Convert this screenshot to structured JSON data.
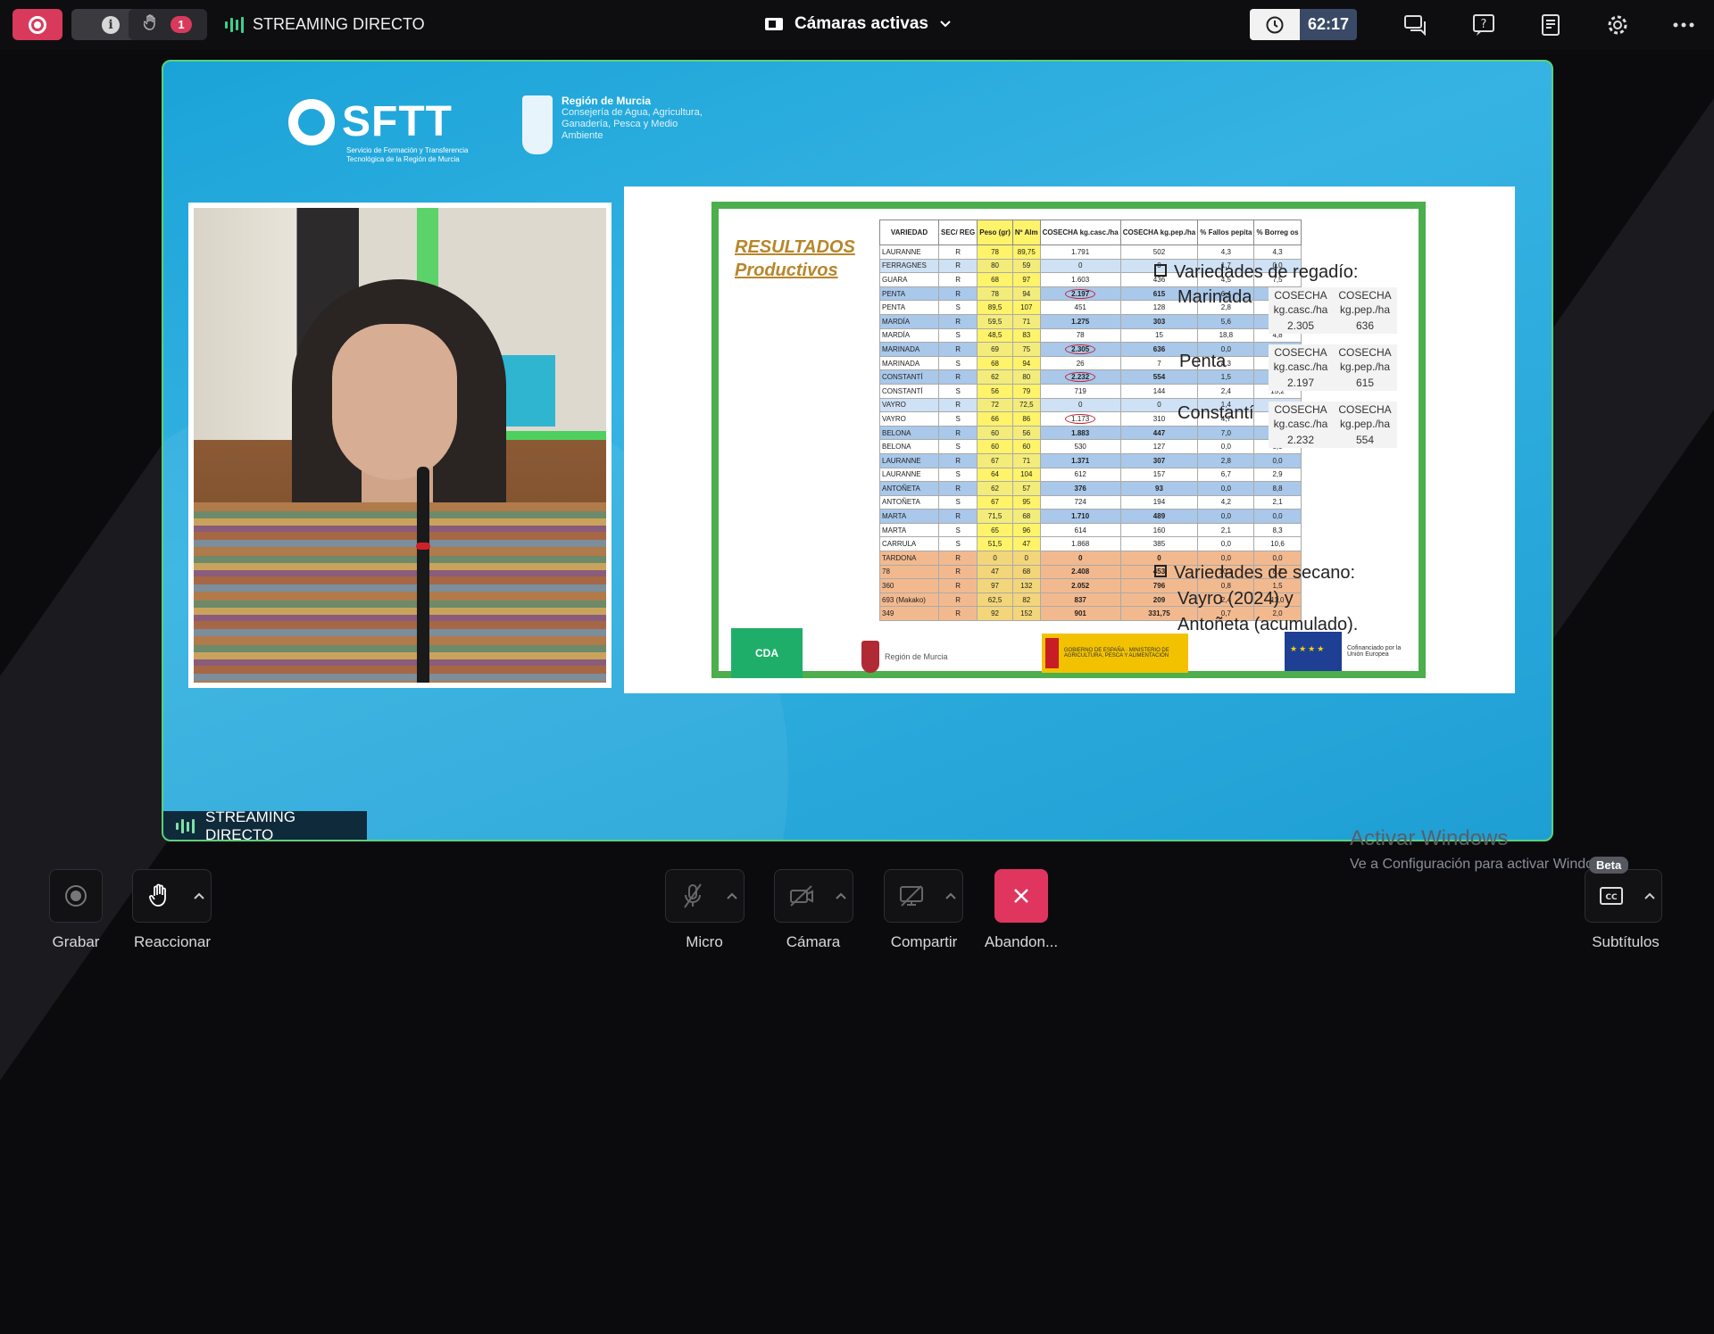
{
  "topbar": {
    "hand_count": "1",
    "stream_label": "STREAMING DIRECTO",
    "cameras_label": "Cámaras activas",
    "timer": "62:17"
  },
  "slide": {
    "sftt_logo": "SFTT",
    "sftt_sub": "Servicio de Formación y Transferencia Tecnológica de la Región de Murcia",
    "murcia_title": "Región de Murcia",
    "murcia_sub": "Consejería de Agua, Agricultura, Ganadería, Pesca y Medio Ambiente",
    "results_title_1": "RESULTADOS",
    "results_title_2": "Productivos",
    "table_headers": [
      "VARIEDAD",
      "SEC/ REG",
      "Peso (gr)",
      "Nº Alm",
      "COSECHA kg.casc./ha",
      "COSECHA kg.pep./ha",
      "% Fallos pepita",
      "% Borreg os"
    ],
    "table_rows": [
      {
        "v": "LAURANNE",
        "r": "R",
        "p": "78",
        "n": "89,75",
        "c": "1.791",
        "k": "502",
        "f": "4,3",
        "b": "4,3",
        "s": "w"
      },
      {
        "v": "FERRAGNES",
        "r": "R",
        "p": "80",
        "n": "59",
        "c": "0",
        "k": "0",
        "f": "1,7",
        "b": "0,0",
        "s": "lb"
      },
      {
        "v": "GUARA",
        "r": "R",
        "p": "68",
        "n": "97",
        "c": "1.603",
        "k": "436",
        "f": "4,5",
        "b": "7,5",
        "s": "w"
      },
      {
        "v": "PENTA",
        "r": "R",
        "p": "78",
        "n": "94",
        "c": "2.197",
        "k": "615",
        "f": "6,4",
        "b": "0,0",
        "s": "blue",
        "circ": true
      },
      {
        "v": "PENTA",
        "r": "S",
        "p": "89,5",
        "n": "107",
        "c": "451",
        "k": "128",
        "f": "2,8",
        "b": "0,0",
        "s": "w"
      },
      {
        "v": "MARDÍA",
        "r": "R",
        "p": "59,5",
        "n": "71",
        "c": "1.275",
        "k": "303",
        "f": "5,6",
        "b": "1,4",
        "s": "blue"
      },
      {
        "v": "MARDÍA",
        "r": "S",
        "p": "48,5",
        "n": "83",
        "c": "78",
        "k": "15",
        "f": "18,8",
        "b": "4,8",
        "s": "w"
      },
      {
        "v": "MARINADA",
        "r": "R",
        "p": "69",
        "n": "75",
        "c": "2.305",
        "k": "636",
        "f": "0,0",
        "b": "0,0",
        "s": "blue",
        "circ": true
      },
      {
        "v": "MARINADA",
        "r": "S",
        "p": "68",
        "n": "94",
        "c": "26",
        "k": "7",
        "f": "4,3",
        "b": "2,1",
        "s": "w"
      },
      {
        "v": "CONSTANTÍ",
        "r": "R",
        "p": "62",
        "n": "80",
        "c": "2.232",
        "k": "554",
        "f": "1,5",
        "b": "1,5",
        "s": "blue",
        "circ": true
      },
      {
        "v": "CONSTANTÍ",
        "r": "S",
        "p": "56",
        "n": "79",
        "c": "719",
        "k": "144",
        "f": "2,4",
        "b": "15,2",
        "s": "w"
      },
      {
        "v": "VAYRO",
        "r": "R",
        "p": "72",
        "n": "72,5",
        "c": "0",
        "k": "0",
        "f": "1,4",
        "b": "0,0",
        "s": "lb"
      },
      {
        "v": "VAYRO",
        "r": "S",
        "p": "66",
        "n": "86",
        "c": "1.173",
        "k": "310",
        "f": "4,7",
        "b": "0,0",
        "s": "w",
        "circ": true
      },
      {
        "v": "BELONA",
        "r": "R",
        "p": "60",
        "n": "56",
        "c": "1.883",
        "k": "447",
        "f": "7,0",
        "b": "3,6",
        "s": "blue"
      },
      {
        "v": "BELONA",
        "r": "S",
        "p": "60",
        "n": "60",
        "c": "530",
        "k": "127",
        "f": "0,0",
        "b": "0,0",
        "s": "w"
      },
      {
        "v": "LAURANNE",
        "r": "R",
        "p": "67",
        "n": "71",
        "c": "1.371",
        "k": "307",
        "f": "2,8",
        "b": "0,0",
        "s": "blue"
      },
      {
        "v": "LAURANNE",
        "r": "S",
        "p": "64",
        "n": "104",
        "c": "612",
        "k": "157",
        "f": "6,7",
        "b": "2,9",
        "s": "w"
      },
      {
        "v": "ANTOÑETA",
        "r": "R",
        "p": "62",
        "n": "57",
        "c": "376",
        "k": "93",
        "f": "0,0",
        "b": "8,8",
        "s": "blue"
      },
      {
        "v": "ANTOÑETA",
        "r": "S",
        "p": "67",
        "n": "95",
        "c": "724",
        "k": "194",
        "f": "4,2",
        "b": "2,1",
        "s": "w"
      },
      {
        "v": "MARTA",
        "r": "R",
        "p": "71,5",
        "n": "68",
        "c": "1.710",
        "k": "489",
        "f": "0,0",
        "b": "0,0",
        "s": "blue"
      },
      {
        "v": "MARTA",
        "r": "S",
        "p": "65",
        "n": "96",
        "c": "614",
        "k": "160",
        "f": "2,1",
        "b": "8,3",
        "s": "w"
      },
      {
        "v": "CARRULA",
        "r": "S",
        "p": "51,5",
        "n": "47",
        "c": "1.868",
        "k": "385",
        "f": "0,0",
        "b": "10,6",
        "s": "w"
      },
      {
        "v": "TARDONA",
        "r": "R",
        "p": "0",
        "n": "0",
        "c": "0",
        "k": "0",
        "f": "0,0",
        "b": "0,0",
        "s": "org"
      },
      {
        "v": "78",
        "r": "R",
        "p": "47",
        "n": "68",
        "c": "2.408",
        "k": "453",
        "f": "10,1",
        "b": "8,7",
        "s": "org"
      },
      {
        "v": "360",
        "r": "R",
        "p": "97",
        "n": "132",
        "c": "2.052",
        "k": "796",
        "f": "0,8",
        "b": "1,5",
        "s": "org"
      },
      {
        "v": "693 (Makako)",
        "r": "R",
        "p": "62,5",
        "n": "82",
        "c": "837",
        "k": "209",
        "f": "2,4",
        "b": "11,0",
        "s": "org"
      },
      {
        "v": "349",
        "r": "R",
        "p": "92",
        "n": "152",
        "c": "901",
        "k": "331,75",
        "f": "0,7",
        "b": "2,0",
        "s": "org"
      }
    ],
    "bullet_regadio": "Variedades de regadío:",
    "marinada": "Marinada",
    "penta": "Penta",
    "constanti": "Constantí",
    "cosecha_casc": "COSECHA kg.casc./ha",
    "cosecha_pep": "COSECHA kg.pep./ha",
    "marinada_casc": "2.305",
    "marinada_pep": "636",
    "penta_casc": "2.197",
    "penta_pep": "615",
    "constanti_casc": "2.232",
    "constanti_pep": "554",
    "bullet_secano_1": "Variedades de secano:",
    "bullet_secano_2": "Vayro (2024) y",
    "bullet_secano_3": "Antoñeta (acumulado).",
    "cda": "CDA",
    "region_murcia": "Región de Murcia",
    "gobierno": "GOBIERNO DE ESPAÑA · MINISTERIO DE AGRICULTURA, PESCA Y ALIMENTACIÓN",
    "eu_text": "Cofinanciado por la Unión Europea"
  },
  "stage": {
    "stream_tag": "STREAMING DIRECTO"
  },
  "watermark": {
    "line1": "Activar Windows",
    "line2": "Ve a Configuración para activar Windows."
  },
  "controls": {
    "grabar": "Grabar",
    "reaccionar": "Reaccionar",
    "micro": "Micro",
    "camara": "Cámara",
    "compartir": "Compartir",
    "abandonar": "Abandon...",
    "subtitulos": "Subtítulos",
    "beta": "Beta"
  },
  "colors": {
    "accent_pink": "#d93a5c",
    "stage_border": "#5ad17a",
    "stage_bg": "#1aa3d8",
    "slide_frame": "#4cae4c",
    "timer_bg": "#3a4a66"
  }
}
